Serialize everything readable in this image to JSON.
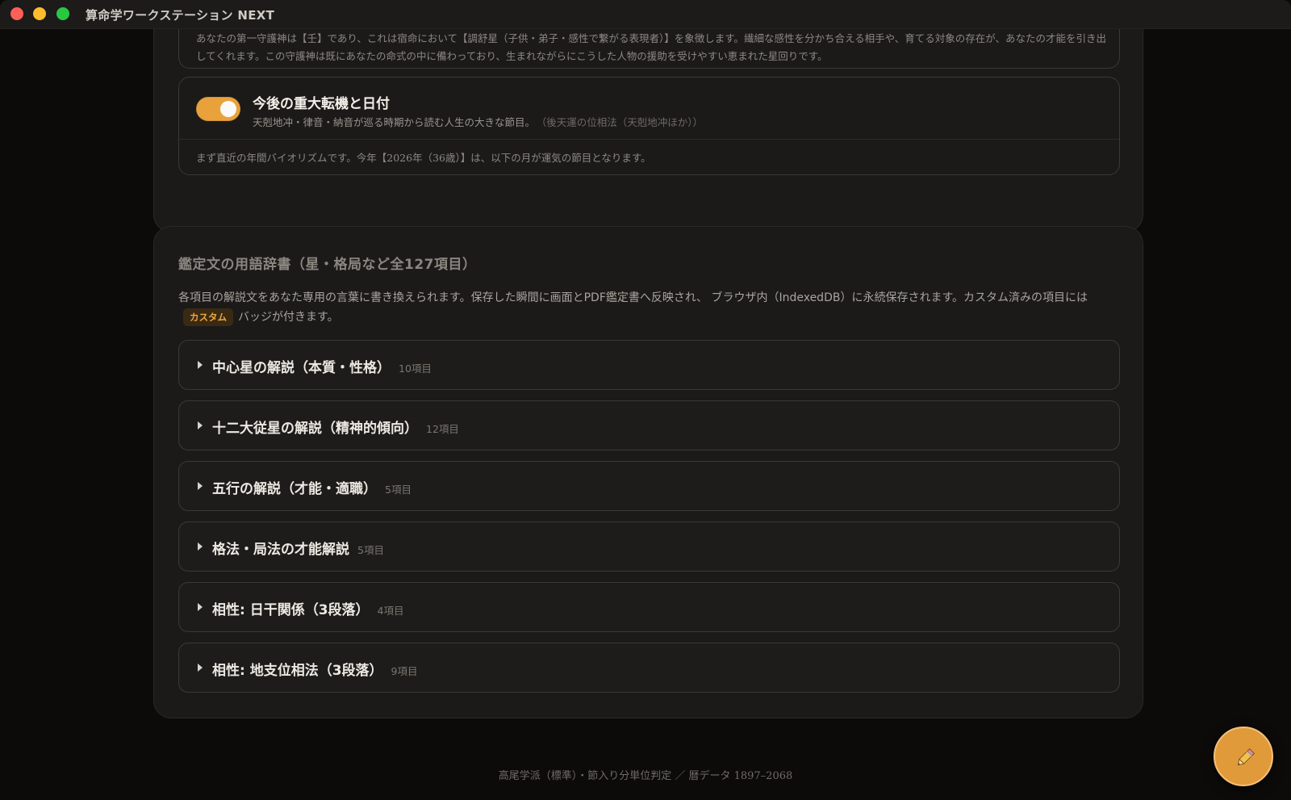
{
  "window": {
    "title": "算命学ワークステーション NEXT"
  },
  "guardian": {
    "text": "あなたの第一守護神は【壬】であり、これは宿命において【調舒星（子供・弟子・感性で繋がる表現者）】を象徴します。繊細な感性を分かち合える相手や、育てる対象の存在が、あなたの才能を引き出してくれます。この守護神は既にあなたの命式の中に備わっており、生まれながらにこうした人物の援助を受けやすい恵まれた星回りです。"
  },
  "turning_points": {
    "toggle_on": true,
    "title": "今後の重大転機と日付",
    "subtitle": "天剋地冲・律音・納音が巡る時期から読む人生の大きな節目。",
    "note": "（後天運の位相法（天剋地冲ほか））",
    "body": "まず直近の年間バイオリズムです。今年【2026年（36歳）】は、以下の月が運気の節目となります。"
  },
  "dictionary": {
    "heading": "鑑定文の用語辞書（星・格局など全127項目）",
    "desc_before": "各項目の解説文をあなた専用の言葉に書き換えられます。保存した瞬間に画面とPDF鑑定書へ反映され、 ブラウザ内（IndexedDB）に永続保存されます。カスタム済みの項目には",
    "badge": "カスタム",
    "desc_after": "バッジが付きます。",
    "sections": [
      {
        "title": "中心星の解説（本質・性格）",
        "count": "10項目"
      },
      {
        "title": "十二大従星の解説（精神的傾向）",
        "count": "12項目"
      },
      {
        "title": "五行の解説（才能・適職）",
        "count": "5項目"
      },
      {
        "title": "格法・局法の才能解説",
        "count": "5項目"
      },
      {
        "title": "相性: 日干関係（3段落）",
        "count": "4項目"
      },
      {
        "title": "相性: 地支位相法（3段落）",
        "count": "9項目"
      }
    ]
  },
  "footer": {
    "text": "高尾学派（標準）・節入り分単位判定 ／ 暦データ 1897–2068"
  },
  "colors": {
    "accent": "#e9a23b",
    "panel": "#1b1a19",
    "background": "#0b0a09"
  },
  "icons": {
    "fab": "pencil-icon",
    "accordion": "caret-right-icon"
  }
}
